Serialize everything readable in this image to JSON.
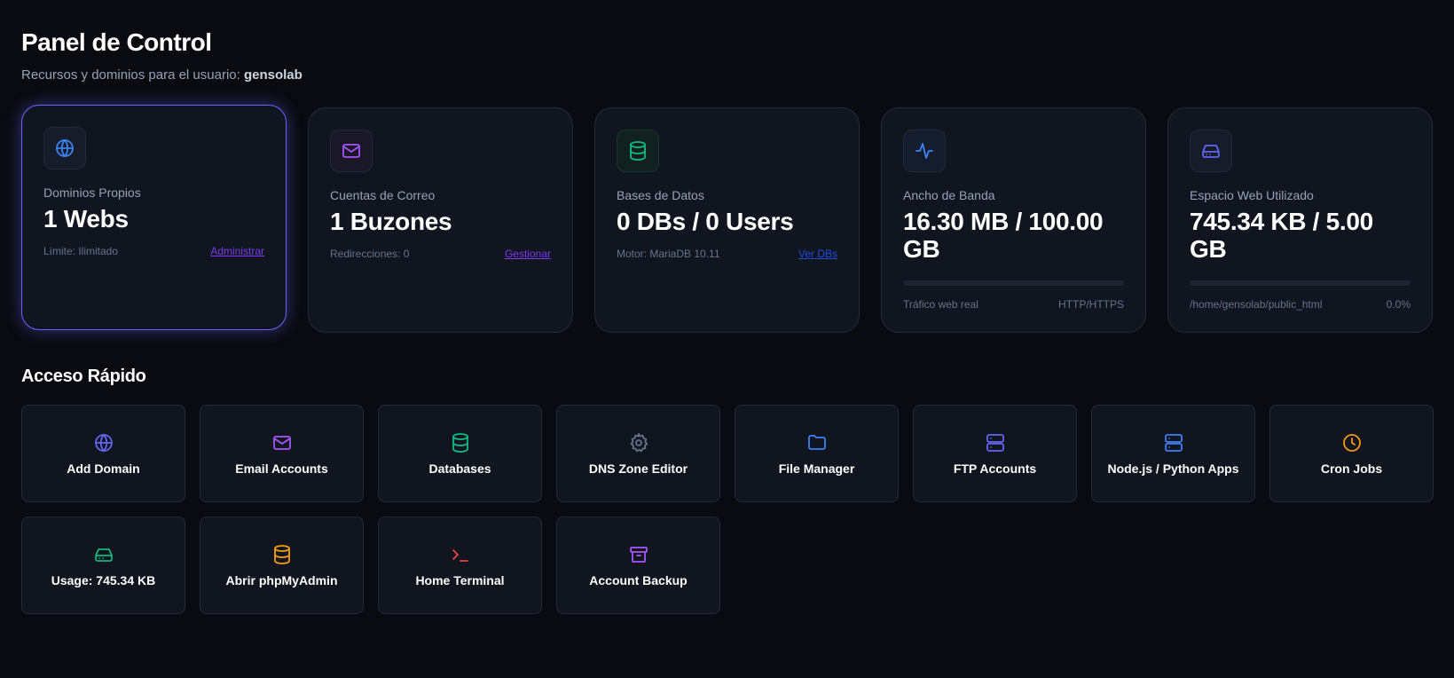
{
  "header": {
    "title": "Panel de Control",
    "subtitle_prefix": "Recursos y dominios para el usuario:",
    "username": "gensolab"
  },
  "cards": {
    "domains": {
      "label": "Dominios Propios",
      "value": "1 Webs",
      "foot_left": "Límite: Ilimitado",
      "link": "Administrar",
      "icon": "globe-icon",
      "color": "#3b82f6"
    },
    "email": {
      "label": "Cuentas de Correo",
      "value": "1 Buzones",
      "foot_left": "Redirecciones: 0",
      "link": "Gestionar",
      "icon": "mail-icon",
      "color": "#a855f7"
    },
    "databases": {
      "label": "Bases de Datos",
      "value": "0 DBs / 0 Users",
      "foot_left": "Motor: MariaDB 10.11",
      "link": "Ver DBs",
      "icon": "database-icon",
      "color": "#10b981"
    },
    "bandwidth": {
      "label": "Ancho de Banda",
      "value": "16.30 MB / 100.00 GB",
      "foot_left": "Tráfico web real",
      "foot_right": "HTTP/HTTPS",
      "usage_fraction": 0.0002,
      "icon": "activity-icon",
      "color": "#3b82f6"
    },
    "disk": {
      "label": "Espacio Web Utilizado",
      "value": "745.34 KB / 5.00 GB",
      "foot_left": "/home/gensolab/public_html",
      "foot_right": "0.0%",
      "usage_fraction": 0.0,
      "icon": "hard-drive-icon",
      "color": "#6366f1"
    }
  },
  "quick_access": {
    "title": "Acceso Rápido",
    "items": [
      {
        "label": "Add Domain",
        "icon": "globe-icon",
        "color": "#6366f1"
      },
      {
        "label": "Email Accounts",
        "icon": "mail-icon",
        "color": "#a855f7"
      },
      {
        "label": "Databases",
        "icon": "database-icon",
        "color": "#10b981"
      },
      {
        "label": "DNS Zone Editor",
        "icon": "gear-icon",
        "color": "#64748b"
      },
      {
        "label": "File Manager",
        "icon": "folder-icon",
        "color": "#3b82f6"
      },
      {
        "label": "FTP Accounts",
        "icon": "server-icon",
        "color": "#6366f1"
      },
      {
        "label": "Node.js / Python Apps",
        "icon": "server-icon",
        "color": "#3b82f6"
      },
      {
        "label": "Cron Jobs",
        "icon": "clock-icon",
        "color": "#f59e0b"
      },
      {
        "label": "Usage: 745.34 KB",
        "icon": "hard-drive-icon",
        "color": "#10b981"
      },
      {
        "label": "Abrir phpMyAdmin",
        "icon": "database-icon",
        "color": "#f59e0b"
      },
      {
        "label": "Home Terminal",
        "icon": "terminal-icon",
        "color": "#ef4444"
      },
      {
        "label": "Account Backup",
        "icon": "archive-icon",
        "color": "#a855f7"
      }
    ]
  }
}
